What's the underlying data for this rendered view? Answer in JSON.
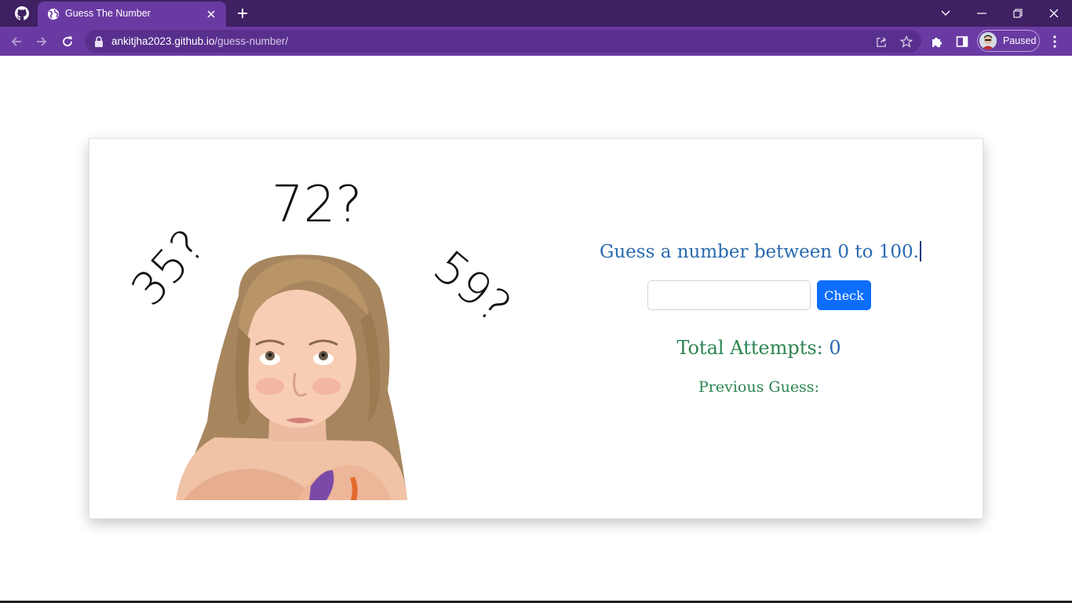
{
  "browser": {
    "tab": {
      "title": "Guess The Number"
    },
    "omnibox": {
      "host": "ankitjha2023.github.io",
      "path": "/guess-number/"
    },
    "profile": {
      "label": "Paused"
    },
    "colors": {
      "frame": "#3f2063",
      "toolbar": "#6a3aa3",
      "omnibox": "#582f8d"
    }
  },
  "game": {
    "illustration": {
      "numbers": [
        "72?",
        "35?",
        "59?"
      ]
    },
    "prompt": "Guess a number between 0 to 100.",
    "input": {
      "value": "",
      "placeholder": ""
    },
    "check_label": "Check",
    "attempts_label": "Total Attempts:",
    "attempts_count": "0",
    "previous_label": "Previous Guess:",
    "previous_values": "",
    "colors": {
      "prompt": "#2a6ab0",
      "stats": "#2b8550",
      "button": "#0d6efd"
    }
  }
}
